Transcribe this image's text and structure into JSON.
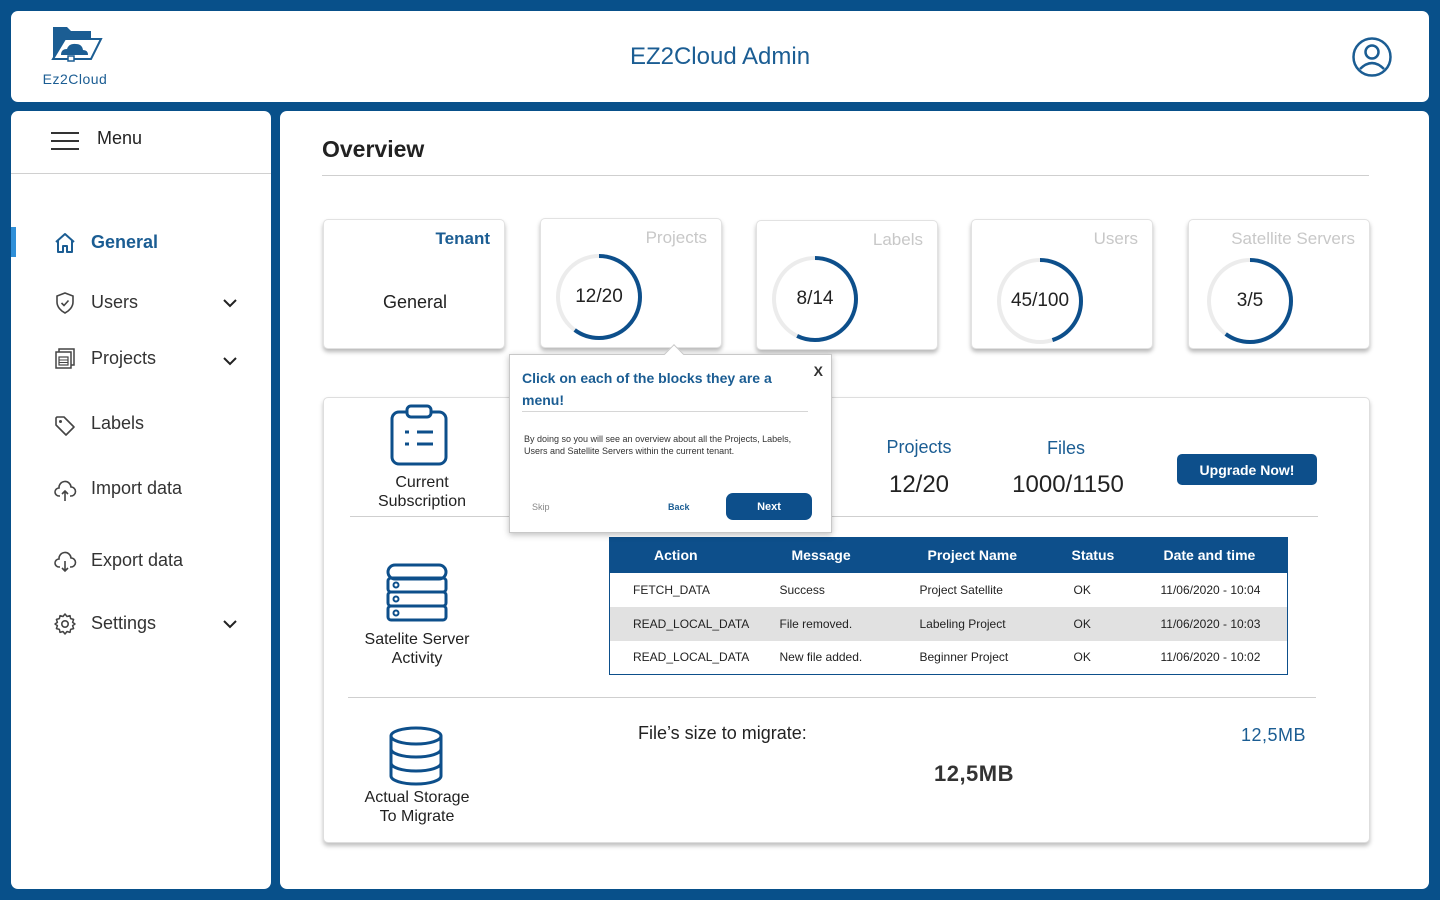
{
  "header": {
    "logo_text": "Ez2Cloud",
    "title": "EZ2Cloud Admin"
  },
  "sidebar": {
    "menu_label": "Menu",
    "items": [
      {
        "label": "General",
        "icon": "home-icon",
        "active": true
      },
      {
        "label": "Users",
        "icon": "shield-icon",
        "expandable": true
      },
      {
        "label": "Projects",
        "icon": "projects-icon",
        "expandable": true
      },
      {
        "label": "Labels",
        "icon": "tag-icon"
      },
      {
        "label": "Import data",
        "icon": "upload-cloud-icon"
      },
      {
        "label": "Export data",
        "icon": "download-cloud-icon"
      },
      {
        "label": "Settings",
        "icon": "gear-icon",
        "expandable": true
      }
    ]
  },
  "overview": {
    "title": "Overview",
    "cards": [
      {
        "title": "Tenant",
        "value": "General"
      },
      {
        "title": "Projects",
        "value": "12/20",
        "progress": 0.6
      },
      {
        "title": "Labels",
        "value": "8/14",
        "progress": 0.571
      },
      {
        "title": "Users",
        "value": "45/100",
        "progress": 0.45
      },
      {
        "title": "Satellite Servers",
        "value": "3/5",
        "progress": 0.6
      }
    ]
  },
  "subscription": {
    "label_line1": "Current",
    "label_line2": "Subscription",
    "projects_head": "Projects",
    "projects_value": "12/20",
    "files_head": "Files",
    "files_value": "1000/1150",
    "upgrade_label": "Upgrade Now!"
  },
  "activity": {
    "label_line1": "Satelite Server",
    "label_line2": "Activity",
    "columns": [
      "Action",
      "Message",
      "Project Name",
      "Status",
      "Date and time"
    ],
    "rows": [
      [
        "FETCH_DATA",
        "Success",
        "Project Satellite",
        "OK",
        "11/06/2020 - 10:04"
      ],
      [
        "READ_LOCAL_DATA",
        "File removed.",
        "Labeling Project",
        "OK",
        "11/06/2020 - 10:03"
      ],
      [
        "READ_LOCAL_DATA",
        "New file added.",
        "Beginner Project",
        "OK",
        "11/06/2020 - 10:02"
      ]
    ]
  },
  "storage": {
    "label_line1": "Actual Storage",
    "label_line2": "To Migrate",
    "size_label": "File’s size to migrate:",
    "size_value": "12,5MB",
    "side_value": "12,5MB"
  },
  "tooltip": {
    "title": "Click on each of the blocks they are a menu!",
    "body": "By doing so you will see an overview about all the Projects, Labels, Users and Satellite Servers within the current tenant.",
    "close": "X",
    "skip": "Skip",
    "back": "Back",
    "next": "Next"
  },
  "colors": {
    "brand": "#0d4f8b",
    "accent": "#1b5d93",
    "background": "#08508a",
    "active_indicator": "#2f8fd8"
  }
}
